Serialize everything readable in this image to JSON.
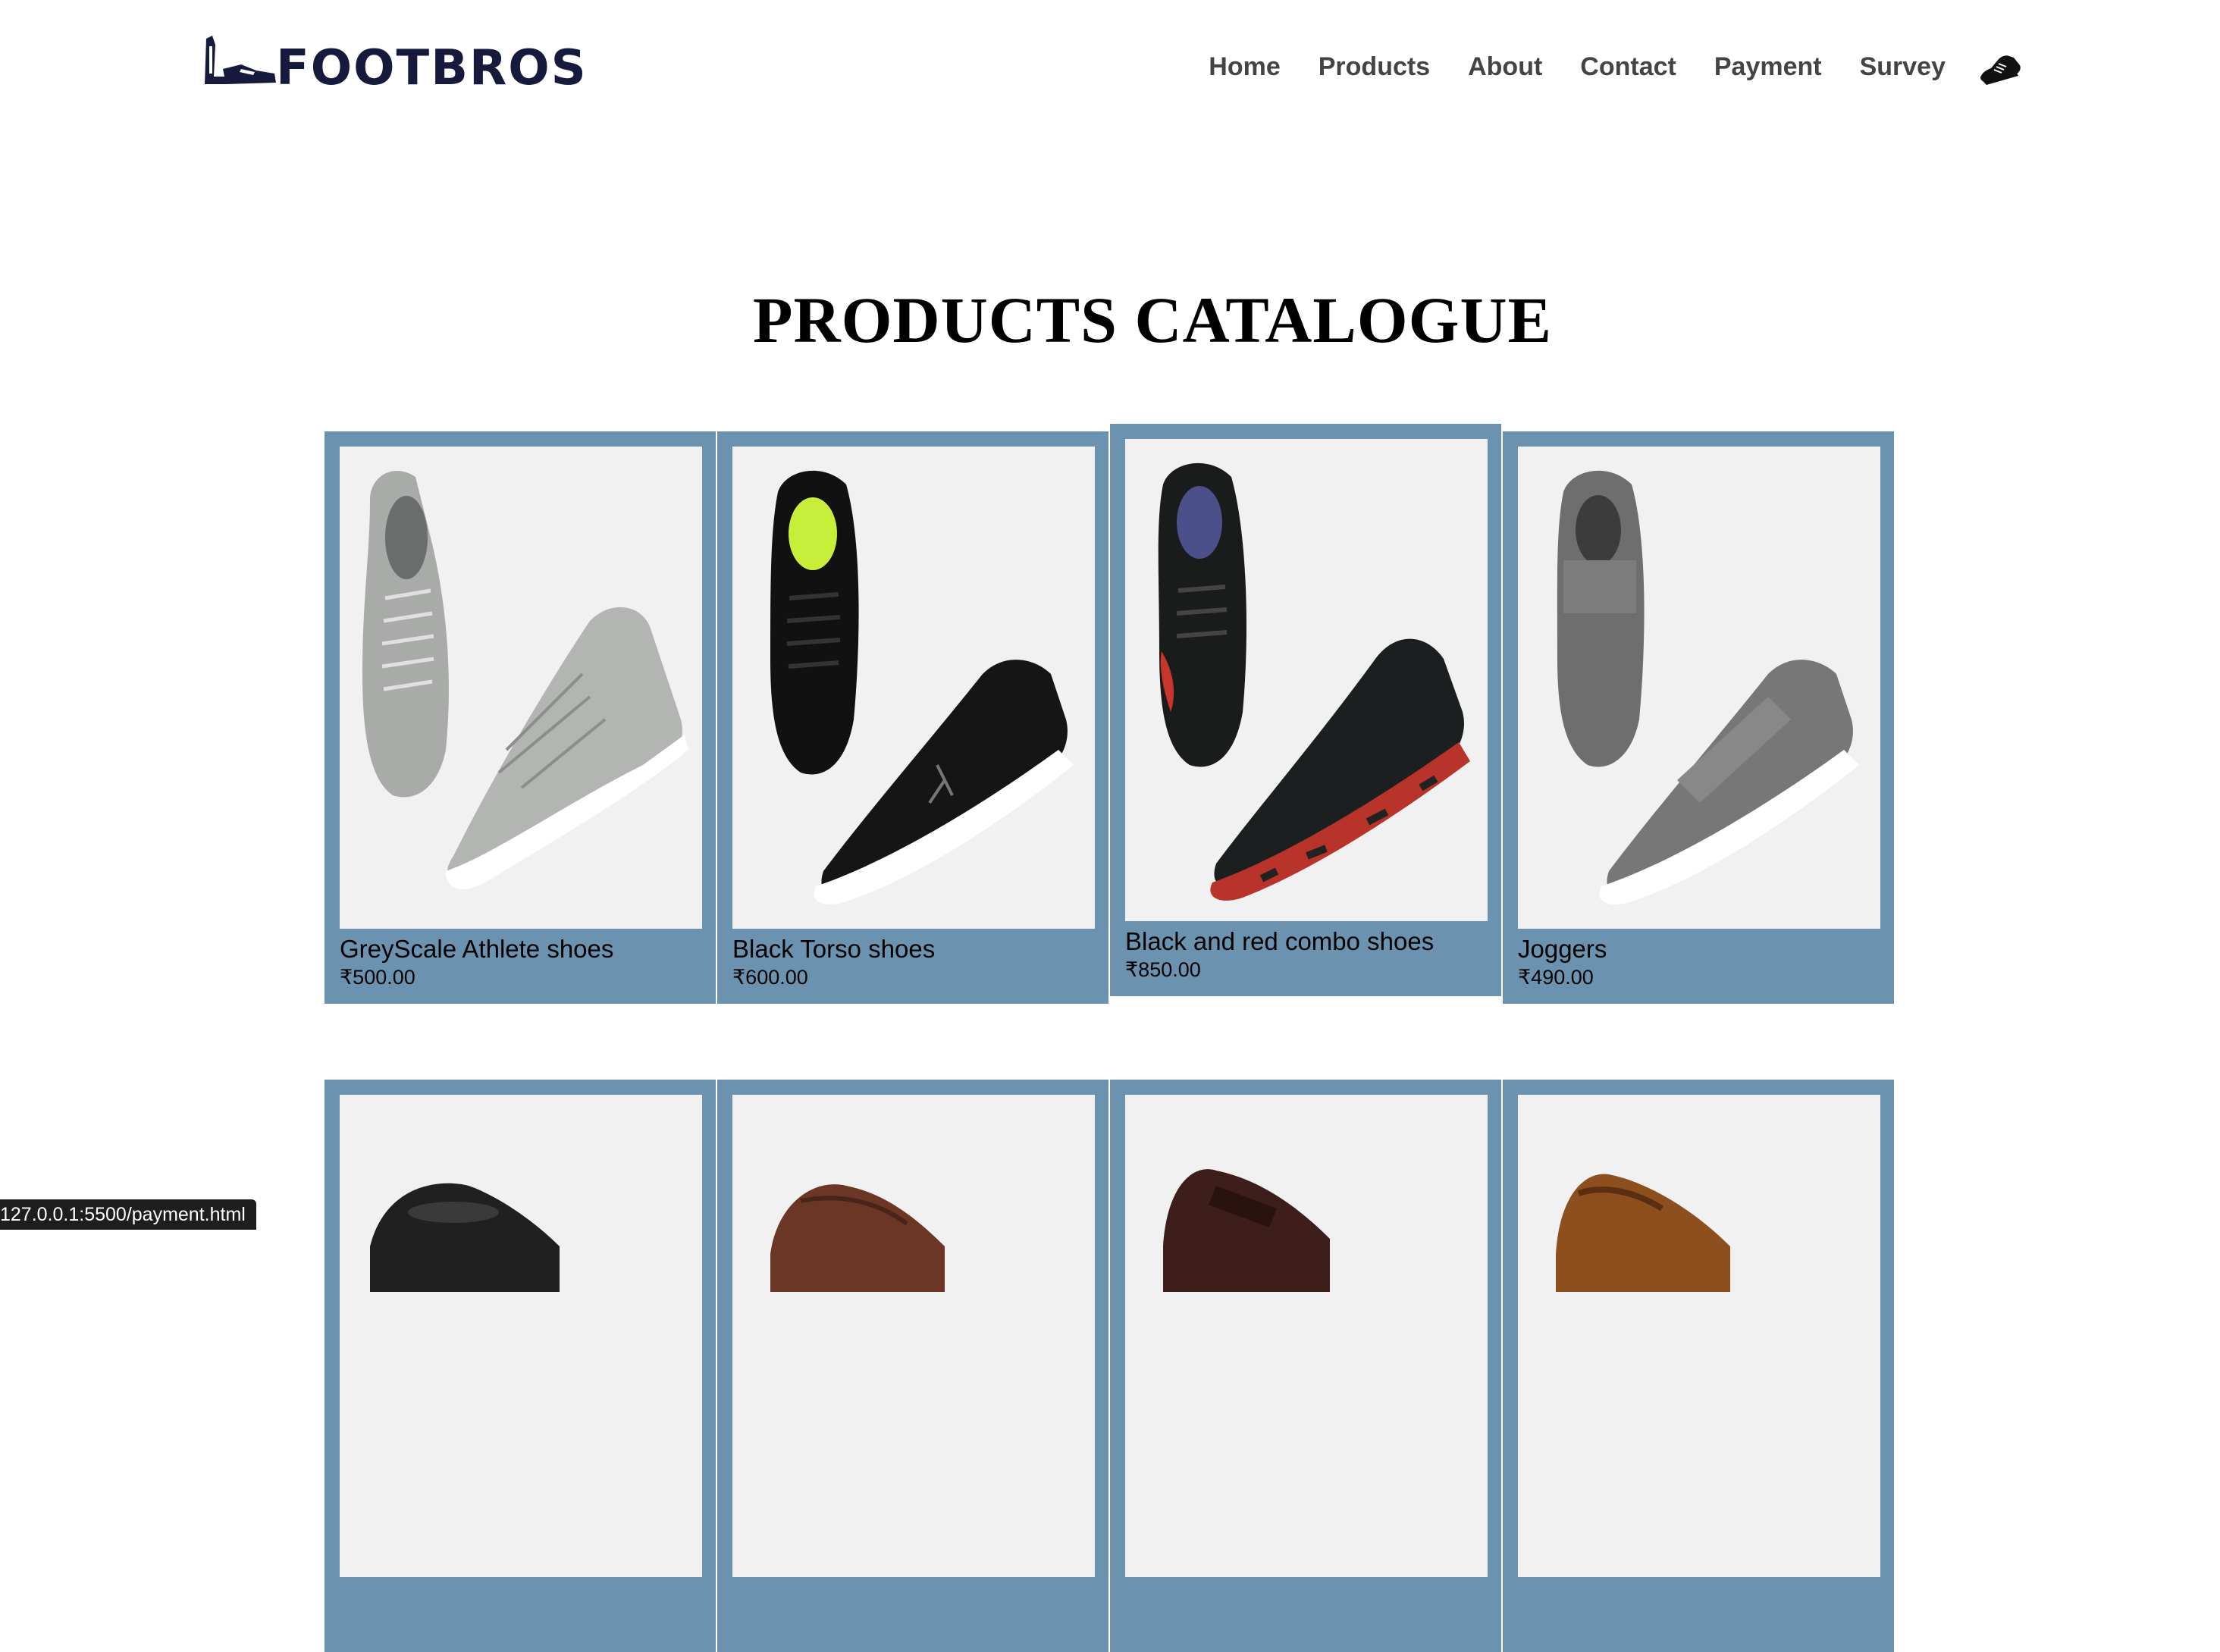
{
  "brand": {
    "name": "FOOTBROS"
  },
  "nav": {
    "items": [
      {
        "label": "Home"
      },
      {
        "label": "Products"
      },
      {
        "label": "About"
      },
      {
        "label": "Contact"
      },
      {
        "label": "Payment"
      },
      {
        "label": "Survey"
      }
    ],
    "cart_icon": "sneaker-icon"
  },
  "page_title": "PRODUCTS CATALOGUE",
  "products": [
    {
      "name": "GreyScale Athlete shoes",
      "price": "₹500.00",
      "image": "grey-high-top-sneakers"
    },
    {
      "name": "Black Torso shoes",
      "price": "₹600.00",
      "image": "black-running-shoes"
    },
    {
      "name": "Black and red combo shoes",
      "price": "₹850.00",
      "image": "black-red-trail-shoes"
    },
    {
      "name": "Joggers",
      "price": "₹490.00",
      "image": "grey-slip-on-joggers"
    }
  ],
  "products_row2": [
    {
      "image": "black-loafers"
    },
    {
      "image": "brown-loafers"
    },
    {
      "image": "dark-brown-loafers"
    },
    {
      "image": "tan-loafers"
    }
  ],
  "status_bar": {
    "url": "127.0.0.1:5500/payment.html"
  },
  "colors": {
    "card_bg": "#6b93b0",
    "image_bg": "#f1f1f1",
    "brand": "#161a3c",
    "nav_text": "#444444"
  }
}
